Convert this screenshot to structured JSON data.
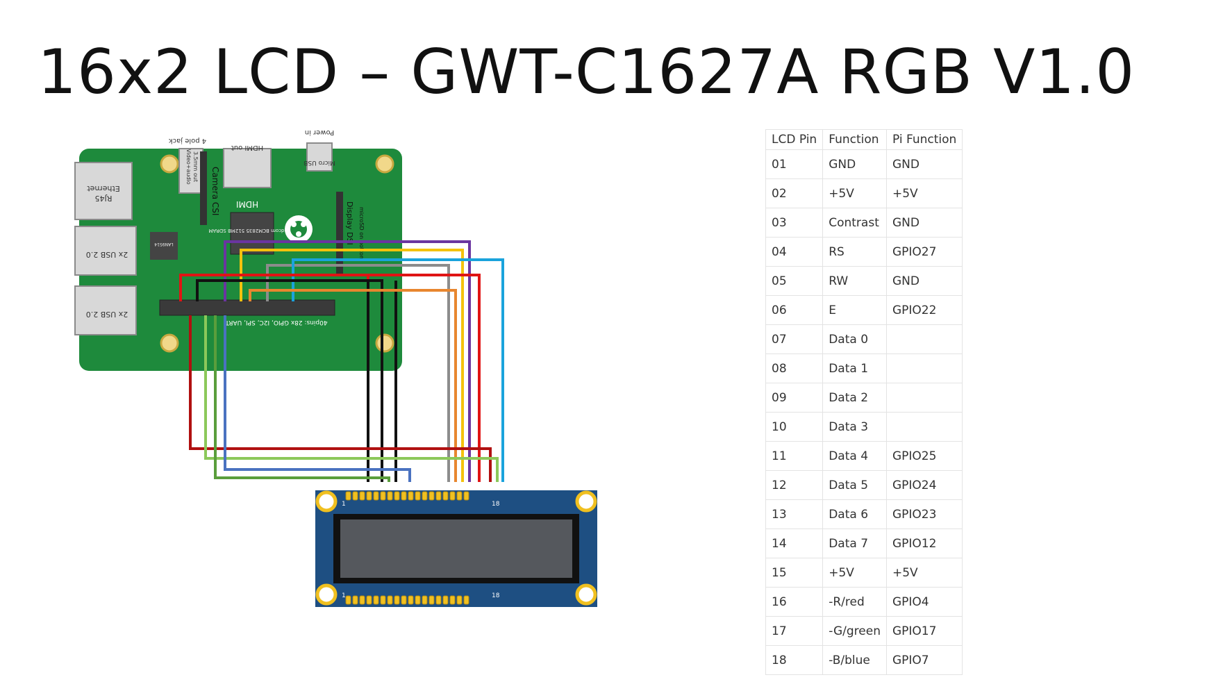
{
  "title": "16x2 LCD – GWT-C1627A RGB V1.0",
  "diagram": {
    "pi_board": {
      "color": "#1e8a3c",
      "labels": {
        "ethernet": "Ethernet",
        "rj45": "RJ45",
        "usb_1": "2x USB 2.0",
        "usb_2": "2x USB 2.0",
        "audio_jack": "4 pole jack",
        "video_audio": "Video+audio",
        "composite": "3.5mm out",
        "camera": "Camera CSI",
        "hdmi_out": "HDMI out",
        "hdmi": "HDMI",
        "power_in": "Power in",
        "micro_usb": "Micro USB",
        "soc": "Broadcom BCM2835 512MB SDRAM",
        "lan_chip": "LAN9514",
        "display": "Display DSI",
        "gpio": "40pins: 28x GPIO, I2C, SPI, UART",
        "microsd": "microSD on bottom"
      }
    },
    "lcd_module": {
      "color": "#1e4f82",
      "screen_color": "#55585d",
      "pin_first_top": "1",
      "pin_last_top": "18",
      "pin_first_bottom": "1",
      "pin_last_bottom": "18"
    },
    "wire_colors": {
      "red": "#e01414",
      "dark_red": "#b01010",
      "black": "#111111",
      "purple": "#6a35a0",
      "yellow": "#f4c20d",
      "gray": "#8c8c8c",
      "blue_light": "#1aa3dc",
      "orange": "#e8862f",
      "green": "#8cc85a",
      "green_dark": "#5a9e3c",
      "blue": "#4a72c0"
    }
  },
  "pin_table": {
    "headers": [
      "LCD Pin",
      "Function",
      "Pi Function"
    ],
    "rows": [
      [
        "01",
        "GND",
        "GND"
      ],
      [
        "02",
        "+5V",
        "+5V"
      ],
      [
        "03",
        "Contrast",
        "GND"
      ],
      [
        "04",
        "RS",
        "GPIO27"
      ],
      [
        "05",
        "RW",
        "GND"
      ],
      [
        "06",
        "E",
        "GPIO22"
      ],
      [
        "07",
        "Data 0",
        ""
      ],
      [
        "08",
        "Data 1",
        ""
      ],
      [
        "09",
        "Data 2",
        ""
      ],
      [
        "10",
        "Data 3",
        ""
      ],
      [
        "11",
        "Data 4",
        "GPIO25"
      ],
      [
        "12",
        "Data 5",
        "GPIO24"
      ],
      [
        "13",
        "Data 6",
        "GPIO23"
      ],
      [
        "14",
        "Data 7",
        "GPIO12"
      ],
      [
        "15",
        "+5V",
        "+5V"
      ],
      [
        "16",
        "-R/red",
        "GPIO4"
      ],
      [
        "17",
        "-G/green",
        "GPIO17"
      ],
      [
        "18",
        "-B/blue",
        "GPIO7"
      ]
    ]
  }
}
